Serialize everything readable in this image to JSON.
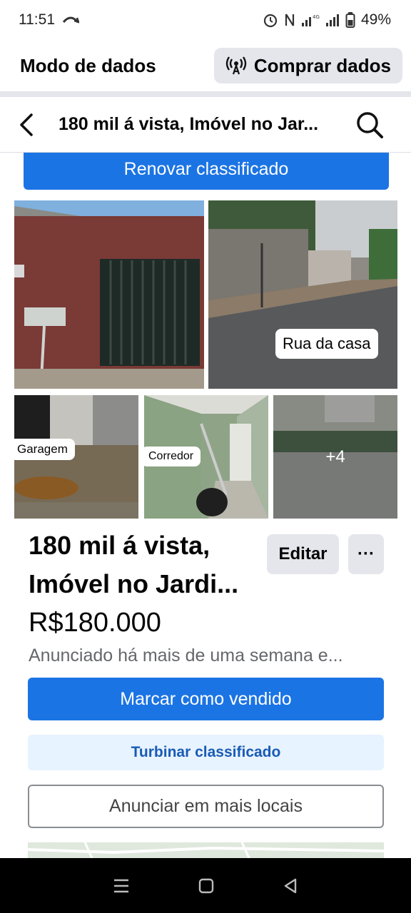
{
  "status_bar": {
    "time": "11:51",
    "battery": "49%",
    "icons": [
      "missed-call-icon",
      "alarm-icon",
      "nfc-icon",
      "signal-4g-icon",
      "signal-icon",
      "battery-icon"
    ]
  },
  "data_mode": {
    "title": "Modo de dados",
    "buy_label": "Comprar dados",
    "buy_icon": "broadcast-icon"
  },
  "nav": {
    "title": "180 mil á vista, Imóvel no Jar...",
    "back_icon": "back-arrow-icon",
    "search_icon": "search-icon"
  },
  "renew_button": "Renovar classificado",
  "photos": {
    "tags": {
      "street": "Rua da casa",
      "garage": "Garagem",
      "corridor": "Corredor"
    },
    "more_count": "+4"
  },
  "listing": {
    "title_line1": "180 mil á vista,",
    "title_line2": "Imóvel no Jardi...",
    "edit_label": "Editar",
    "more_label": "···",
    "price": "R$180.000",
    "posted": "Anunciado há mais de uma semana e..."
  },
  "actions": {
    "mark_sold": "Marcar como vendido",
    "boost": "Turbinar classificado",
    "more_places": "Anunciar em mais locais"
  },
  "colors": {
    "primary": "#1b74e4",
    "secondary_bg": "#e4e6eb",
    "boost_bg": "#e7f3ff",
    "boost_text": "#1a5bb5"
  }
}
